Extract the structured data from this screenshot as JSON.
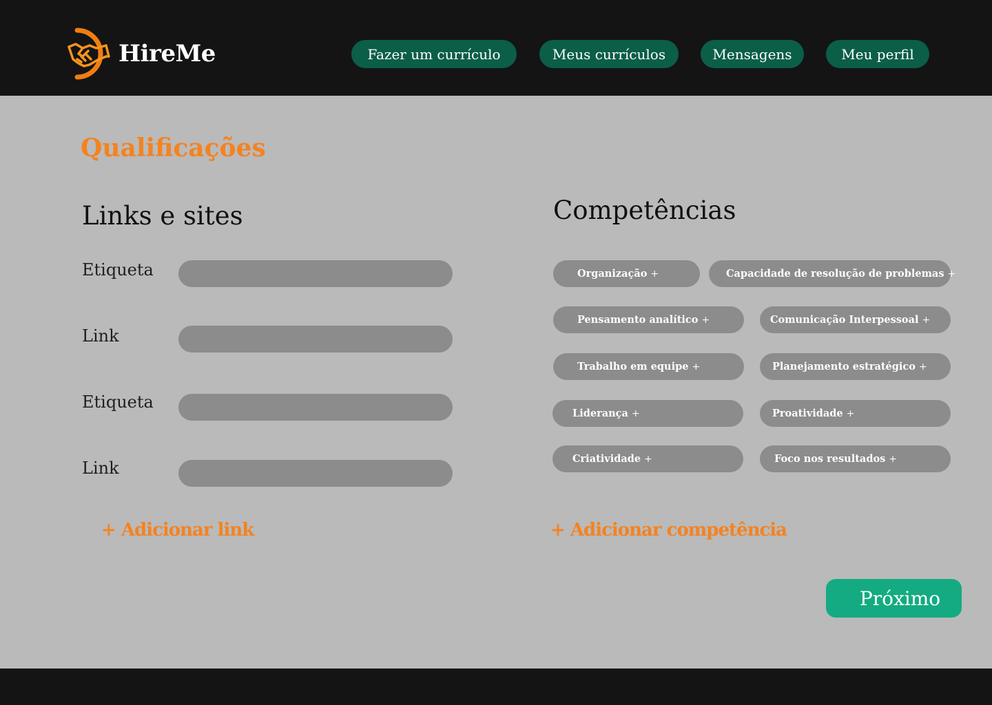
{
  "header": {
    "logo": {
      "icon": "handshake-icon",
      "text": "HireMe"
    },
    "nav": [
      {
        "label": "Fazer um currículo"
      },
      {
        "label": "Meus currículos"
      },
      {
        "label": "Mensagens"
      },
      {
        "label": "Meu perfil"
      }
    ]
  },
  "main": {
    "title": "Qualificações",
    "links_section": {
      "title": "Links e sites",
      "fields": [
        {
          "label": "Etiqueta",
          "value": ""
        },
        {
          "label": "Link",
          "value": ""
        },
        {
          "label": "Etiqueta",
          "value": ""
        },
        {
          "label": "Link",
          "value": ""
        }
      ],
      "add_label": "+ Adicionar link"
    },
    "skills_section": {
      "title": "Competências",
      "skills": [
        {
          "label": "Organização",
          "plus": "+"
        },
        {
          "label": "Capacidade de resolução de problemas",
          "plus": "+"
        },
        {
          "label": "Pensamento analítico",
          "plus": "+"
        },
        {
          "label": "Comunicação Interpessoal",
          "plus": "+"
        },
        {
          "label": "Trabalho em equipe",
          "plus": "+"
        },
        {
          "label": "Planejamento estratégico",
          "plus": "+"
        },
        {
          "label": "Liderança",
          "plus": "+"
        },
        {
          "label": "Proatividade",
          "plus": "+"
        },
        {
          "label": "Criatividade",
          "plus": "+"
        },
        {
          "label": "Foco nos resultados",
          "plus": "+"
        }
      ],
      "add_label": "+ Adicionar competência"
    },
    "next_label": "Próximo"
  },
  "colors": {
    "header_bg": "#141414",
    "page_bg": "#bababa",
    "nav_button": "#0b5e48",
    "accent_orange": "#f5821f",
    "next_button": "#14ab82",
    "chip_bg": "#8c8c8c"
  }
}
